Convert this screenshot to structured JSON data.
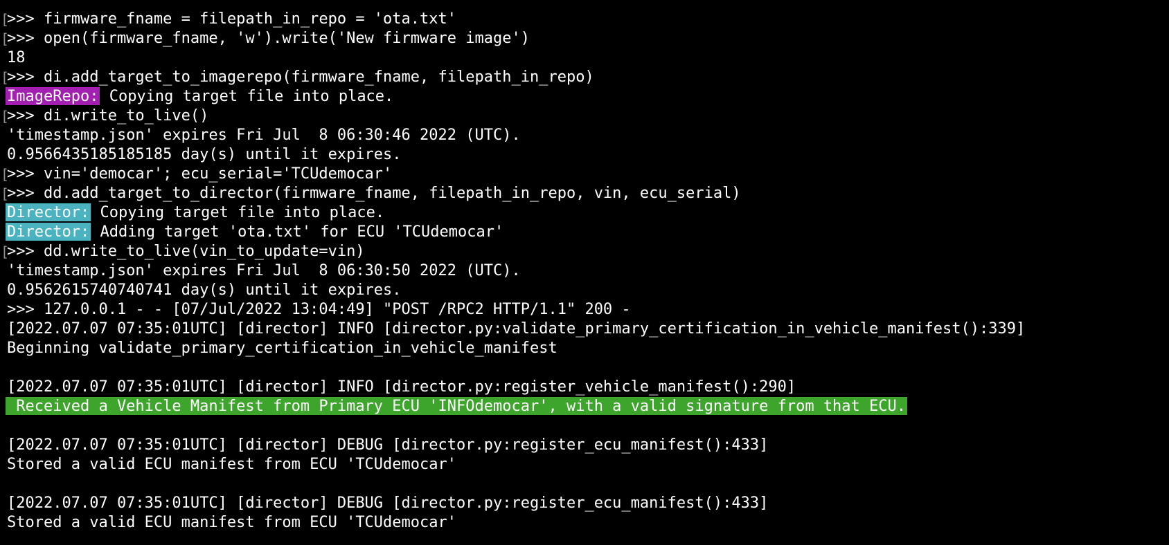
{
  "terminal": {
    "colors": {
      "background": "#000000",
      "text": "#ffffff",
      "image_repo_tag": "#a21fb1",
      "director_tag": "#4bb2c0",
      "success_highlight": "#3ea52c",
      "bracket": "#8c8c8c"
    },
    "lines": [
      {
        "bracket": "[",
        "text": ">>> firmware_fname = filepath_in_repo = 'ota.txt'"
      },
      {
        "bracket": "[",
        "text": ">>> open(firmware_fname, 'w').write('New firmware image')"
      },
      {
        "bracket": "",
        "text": "18"
      },
      {
        "bracket": "[",
        "text": ">>> di.add_target_to_imagerepo(firmware_fname, filepath_in_repo)"
      },
      {
        "bracket": "",
        "tag": "ImageRepo:",
        "tag_style": "image",
        "text": " Copying target file into place."
      },
      {
        "bracket": "[",
        "text": ">>> di.write_to_live()"
      },
      {
        "bracket": "",
        "text": "'timestamp.json' expires Fri Jul  8 06:30:46 2022 (UTC)."
      },
      {
        "bracket": "",
        "text": "0.9566435185185185 day(s) until it expires."
      },
      {
        "bracket": "[",
        "text": ">>> vin='democar'; ecu_serial='TCUdemocar'"
      },
      {
        "bracket": "[",
        "text": ">>> dd.add_target_to_director(firmware_fname, filepath_in_repo, vin, ecu_serial)"
      },
      {
        "bracket": "",
        "tag": "Director:",
        "tag_style": "director",
        "text": " Copying target file into place."
      },
      {
        "bracket": "",
        "tag": "Director:",
        "tag_style": "director",
        "text": " Adding target 'ota.txt' for ECU 'TCUdemocar'"
      },
      {
        "bracket": "[",
        "text": ">>> dd.write_to_live(vin_to_update=vin)"
      },
      {
        "bracket": "",
        "text": "'timestamp.json' expires Fri Jul  8 06:30:50 2022 (UTC)."
      },
      {
        "bracket": "",
        "text": "0.9562615740740741 day(s) until it expires."
      },
      {
        "bracket": "",
        "text": ">>> 127.0.0.1 - - [07/Jul/2022 13:04:49] \"POST /RPC2 HTTP/1.1\" 200 -"
      },
      {
        "bracket": "",
        "text": "[2022.07.07 07:35:01UTC] [director] INFO [director.py:validate_primary_certification_in_vehicle_manifest():339]"
      },
      {
        "bracket": "",
        "text": "Beginning validate_primary_certification_in_vehicle_manifest"
      },
      {
        "bracket": "",
        "text": ""
      },
      {
        "bracket": "",
        "text": "[2022.07.07 07:35:01UTC] [director] INFO [director.py:register_vehicle_manifest():290]"
      },
      {
        "bracket": "",
        "highlight": " Received a Vehicle Manifest from Primary ECU 'INFOdemocar', with a valid signature from that ECU.",
        "text": ""
      },
      {
        "bracket": "",
        "text": ""
      },
      {
        "bracket": "",
        "text": "[2022.07.07 07:35:01UTC] [director] DEBUG [director.py:register_ecu_manifest():433]"
      },
      {
        "bracket": "",
        "text": "Stored a valid ECU manifest from ECU 'TCUdemocar'"
      },
      {
        "bracket": "",
        "text": ""
      },
      {
        "bracket": "",
        "text": "[2022.07.07 07:35:01UTC] [director] DEBUG [director.py:register_ecu_manifest():433]"
      },
      {
        "bracket": "",
        "text": "Stored a valid ECU manifest from ECU 'TCUdemocar'"
      }
    ]
  }
}
